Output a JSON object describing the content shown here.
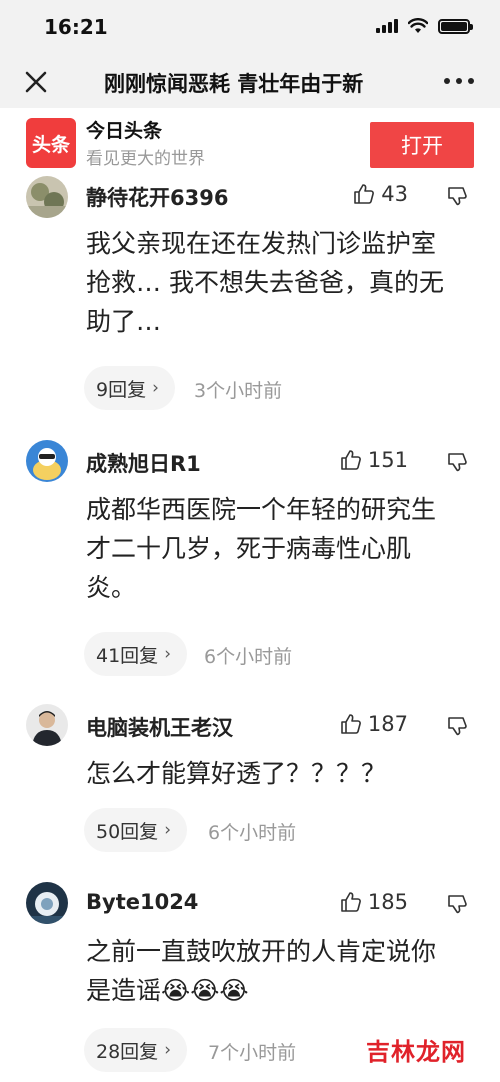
{
  "status_bar": {
    "time": "16:21"
  },
  "nav": {
    "title": "刚刚惊闻恶耗 青壮年由于新"
  },
  "banner": {
    "logo_text": "头条",
    "app_name": "今日头条",
    "slogan": "看见更大的世界",
    "open_label": "打开"
  },
  "comments": [
    {
      "username": "静待花开6396",
      "likes": "43",
      "content": "我父亲现在还在发热门诊监护室抢救… 我不想失去爸爸，真的无助了…",
      "replies": "9回复",
      "time": "3个小时前"
    },
    {
      "username": "成熟旭日R1",
      "likes": "151",
      "content": "成都华西医院一个年轻的研究生才二十几岁，死于病毒性心肌炎。",
      "replies": "41回复",
      "time": "6个小时前"
    },
    {
      "username": "电脑装机王老汉",
      "likes": "187",
      "content": "怎么才能算好透了？？？？",
      "replies": "50回复",
      "time": "6个小时前"
    },
    {
      "username": "Byte1024",
      "likes": "185",
      "content": "之前一直鼓吹放开的人肯定说你是造谣😭😭😭",
      "replies": "28回复",
      "time": "7个小时前"
    }
  ],
  "watermark": "吉林龙网",
  "colors": {
    "brand_red": "#f04545",
    "muted_text": "#999999",
    "pill_bg": "#f4f4f4"
  }
}
